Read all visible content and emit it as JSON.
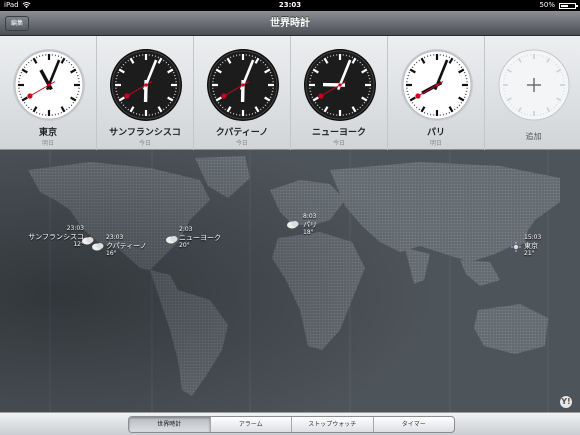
{
  "status": {
    "carrier": "iPad",
    "time": "23:03",
    "battery": "50%",
    "battery_level": 0.5
  },
  "navbar": {
    "edit_label": "編集",
    "title": "世界時計"
  },
  "clocks": [
    {
      "city": "東京",
      "day": "明日",
      "hour": 11,
      "minute": 3,
      "second": 40,
      "theme": "light"
    },
    {
      "city": "サンフランシスコ",
      "day": "今日",
      "hour": 6,
      "minute": 3,
      "second": 40,
      "theme": "dark"
    },
    {
      "city": "クパティーノ",
      "day": "今日",
      "hour": 6,
      "minute": 3,
      "second": 40,
      "theme": "dark"
    },
    {
      "city": "ニューヨーク",
      "day": "今日",
      "hour": 9,
      "minute": 3,
      "second": 40,
      "theme": "dark"
    },
    {
      "city": "パリ",
      "day": "明日",
      "hour": 8,
      "minute": 3,
      "second": 40,
      "theme": "light"
    }
  ],
  "add_clock": {
    "label": "追加"
  },
  "map": {
    "pins": [
      {
        "city": "サンフランシスコ",
        "time": "23:03",
        "temp": "12°"
      },
      {
        "city": "クパティーノ",
        "time": "23:03",
        "temp": "16°"
      },
      {
        "city": "ニューヨーク",
        "time": "2:03",
        "temp": "20°"
      },
      {
        "city": "パリ",
        "time": "8:03",
        "temp": "18°"
      },
      {
        "city": "東京",
        "time": "15:03",
        "temp": "21°"
      }
    ],
    "badge": "Y!"
  },
  "tabs": [
    {
      "label": "世界時計",
      "active": true
    },
    {
      "label": "アラーム",
      "active": false
    },
    {
      "label": "ストップウォッチ",
      "active": false
    },
    {
      "label": "タイマー",
      "active": false
    }
  ],
  "colors": {
    "second_hand": "#d0021b",
    "dark_face": "#1c1c1c",
    "light_face": "#ffffff"
  }
}
